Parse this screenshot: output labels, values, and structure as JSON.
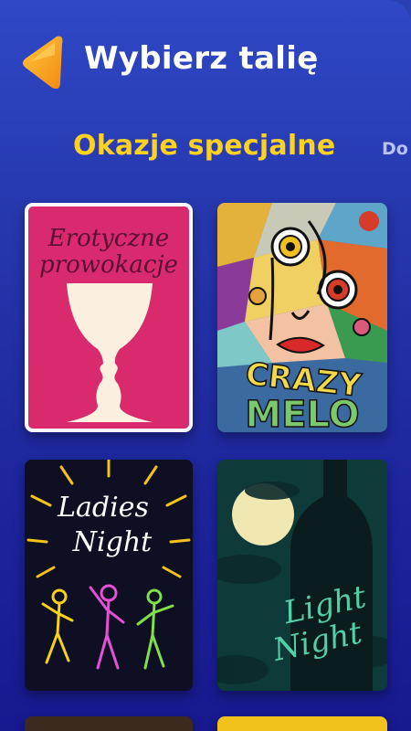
{
  "header": {
    "title": "Wybierz talię",
    "back_icon": "chevron-left-icon"
  },
  "tabs": {
    "active": "Okazje specjalne",
    "next_partial": "Do"
  },
  "decks": [
    {
      "cover_title_line1": "Erotyczne",
      "cover_title_line2": "prowokacje"
    },
    {
      "cover_title_line1": "CRAZY",
      "cover_title_line2": "MELO"
    },
    {
      "cover_title_line1": "Ladies",
      "cover_title_line2": "Night"
    },
    {
      "cover_title_line1": "Light",
      "cover_title_line2": "Night"
    }
  ],
  "colors": {
    "background_top": "#2f48c6",
    "background_bottom": "#17198e",
    "accent_yellow": "#ffd21f",
    "back_button": "#f7a51c",
    "erotic_cover": "#d92a6e"
  }
}
